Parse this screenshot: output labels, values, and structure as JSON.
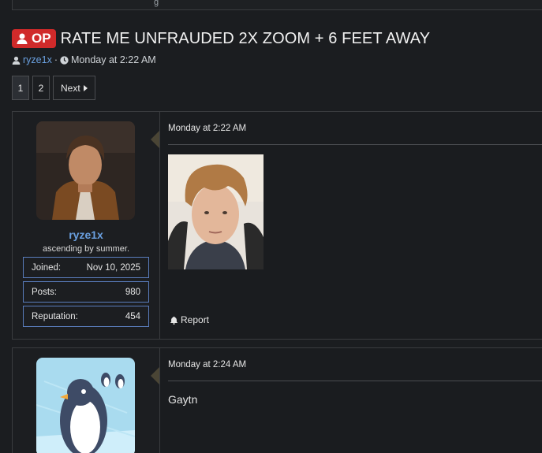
{
  "thread": {
    "op_badge": "OP",
    "title": "RATE ME UNFRAUDED 2X ZOOM + 6 FEET AWAY",
    "author": "ryze1x",
    "separator": "·",
    "date": "Monday at 2:22 AM"
  },
  "pager": {
    "pages": [
      "1",
      "2"
    ],
    "current": "1",
    "next_label": "Next"
  },
  "posts": [
    {
      "username": "ryze1x",
      "user_title": "ascending by summer.",
      "stats": [
        {
          "label": "Joined:",
          "value": "Nov 10, 2025"
        },
        {
          "label": "Posts:",
          "value": "980"
        },
        {
          "label": "Reputation:",
          "value": "454"
        }
      ],
      "date": "Monday at 2:22 AM",
      "report_label": "Report"
    },
    {
      "date": "Monday at 2:24 AM",
      "text": "Gaytn"
    }
  ],
  "colors": {
    "background": "#1b1d20",
    "op_badge": "#d02a2a",
    "link": "#6aa0e0",
    "stat_border": "#5a7dbd"
  },
  "icons": {
    "op": "user-icon",
    "author": "user-icon",
    "date": "clock-icon",
    "next": "caret-right-icon",
    "report": "bell-icon"
  }
}
